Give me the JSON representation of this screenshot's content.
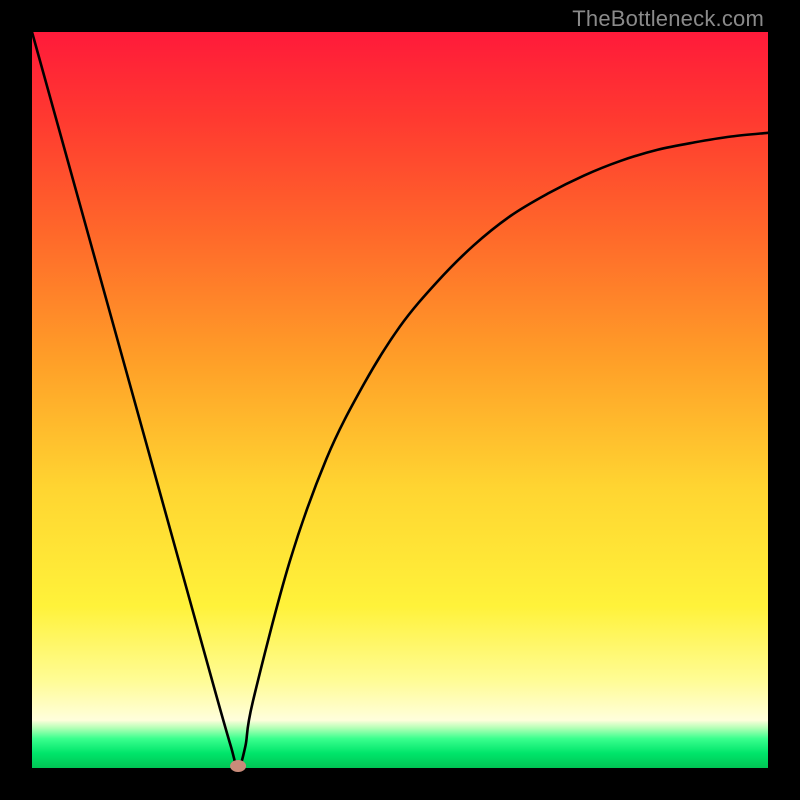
{
  "watermark": "TheBottleneck.com",
  "chart_data": {
    "type": "line",
    "title": "",
    "xlabel": "",
    "ylabel": "",
    "xlim": [
      0,
      100
    ],
    "ylim": [
      0,
      100
    ],
    "legend": false,
    "grid": false,
    "background": "rainbow-gradient-vertical",
    "curve_x": [
      0,
      5,
      10,
      15,
      20,
      25,
      27,
      28,
      29,
      30,
      35,
      40,
      45,
      50,
      55,
      60,
      65,
      70,
      75,
      80,
      85,
      90,
      95,
      100
    ],
    "curve_y": [
      100,
      82,
      64,
      46,
      28,
      10,
      3,
      0,
      3,
      9,
      28,
      42,
      52,
      60,
      66,
      71,
      75,
      78,
      80.5,
      82.5,
      84,
      85,
      85.8,
      86.3
    ],
    "minimum_marker": {
      "x": 28,
      "y": 0,
      "color": "#c98b7a"
    },
    "description": "V-shaped curve with a sharp minimum at x≈28, rising steeply and linearly on the left half and rising with a decelerating slope (concave) on the right half, asymptoting near y≈86 at x=100. No axes, ticks, or numeric labels are visible."
  }
}
